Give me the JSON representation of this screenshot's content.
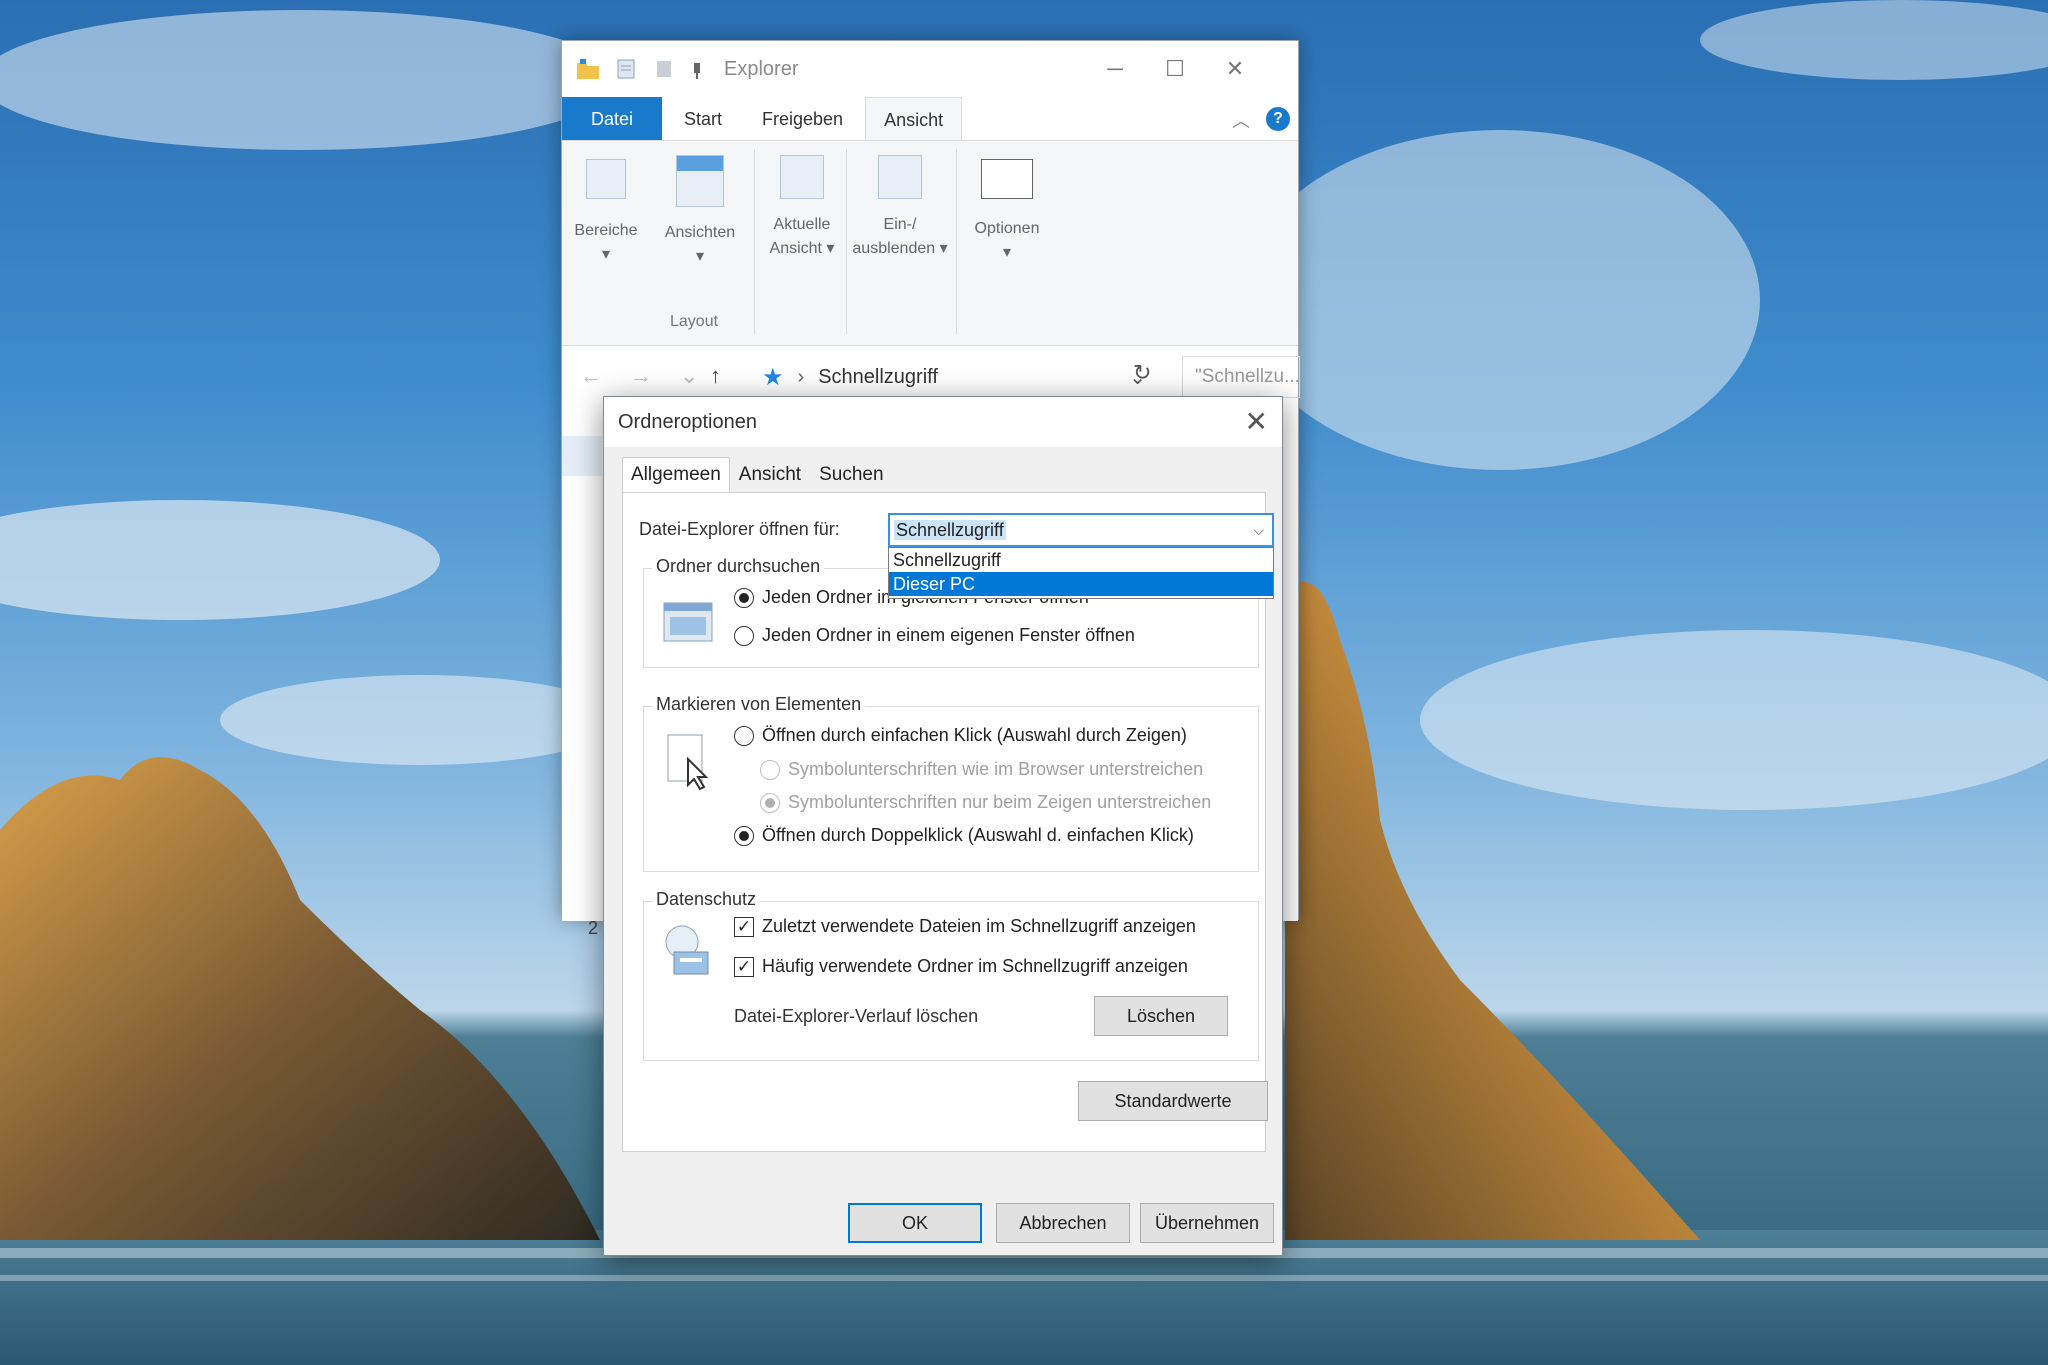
{
  "explorer": {
    "title": "Explorer",
    "tabs": [
      "Datei",
      "Start",
      "Freigeben",
      "Ansicht"
    ],
    "help_label": "?",
    "collapse_icon": "chevron-up-icon",
    "ribbon": {
      "bereiche": "Bereiche",
      "ansichten": "Ansichten",
      "group_layout": "Layout",
      "aktuelle_line1": "Aktuelle",
      "aktuelle_line2": "Ansicht ▾",
      "ein_line1": "Ein-/",
      "ein_line2": "ausblenden ▾",
      "optionen": "Optionen",
      "dropdown_marker": "▾"
    },
    "address": {
      "location": "Schnellzugriff",
      "search_placeholder": "\"Schnellzu..."
    },
    "status_count": "2"
  },
  "dialog": {
    "title": "Ordneroptionen",
    "close_glyph": "✕",
    "tabs": [
      "Allgemeen",
      "Ansicht",
      "Suchen"
    ],
    "open_for_label": "Datei-Explorer öffnen für:",
    "open_for_value": "Schnellzugriff",
    "dropdown_options": [
      "Schnellzugriff",
      "Dieser PC"
    ],
    "browse": {
      "title": "Ordner durchsuchen",
      "option_same": "Jeden Ordner im gleichen Fenster öffnen",
      "option_own": "Jeden Ordner in einem eigenen Fenster öffnen"
    },
    "click": {
      "title": "Markieren von Elementen",
      "single": "Öffnen durch einfachen Klick (Auswahl durch Zeigen)",
      "underline_browser": "Symbolunterschriften wie im Browser unterstreichen",
      "underline_hover": "Symbolunterschriften nur beim Zeigen unterstreichen",
      "double": "Öffnen durch Doppelklick (Auswahl d. einfachen Klick)"
    },
    "privacy": {
      "title": "Datenschutz",
      "recent_files": "Zuletzt verwendete Dateien im Schnellzugriff anzeigen",
      "frequent_folders": "Häufig verwendete Ordner im Schnellzugriff anzeigen",
      "clear_label": "Datei-Explorer-Verlauf löschen",
      "clear_button": "Löschen"
    },
    "defaults_button": "Standardwerte",
    "ok_button": "OK",
    "cancel_button": "Abbrechen",
    "apply_button": "Übernehmen",
    "check_glyph": "✓"
  },
  "colors": {
    "accent": "#0078d7",
    "file_tab": "#1979ca",
    "dialog_bg": "#f0f0f0"
  }
}
